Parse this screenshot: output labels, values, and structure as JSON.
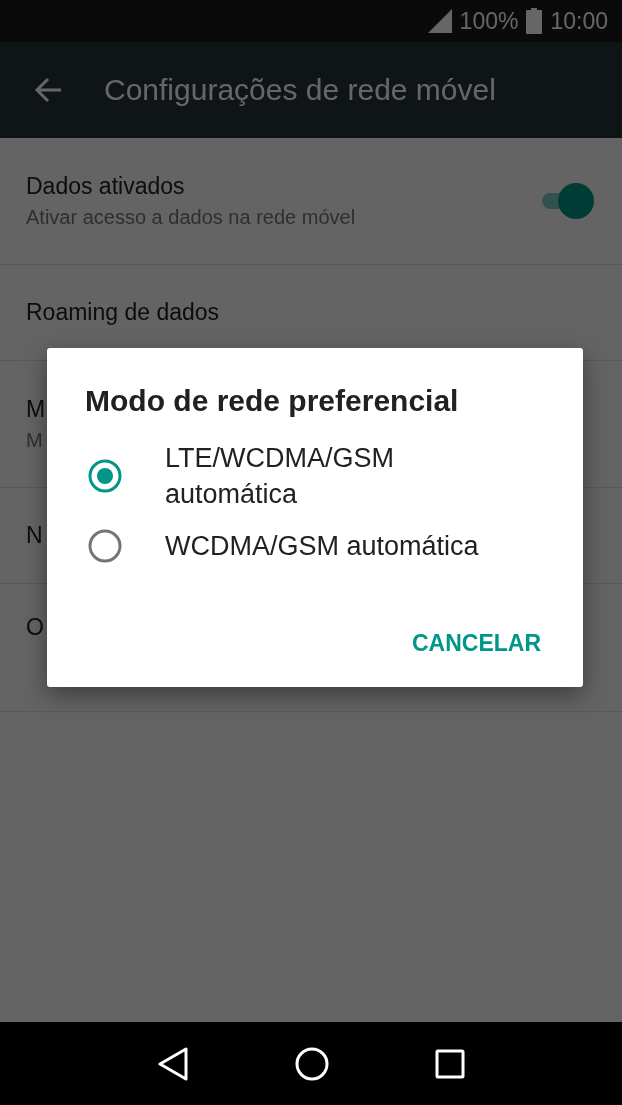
{
  "status_bar": {
    "battery": "100%",
    "time": "10:00"
  },
  "toolbar": {
    "title": "Configurações de rede móvel"
  },
  "settings": [
    {
      "kind": "switch",
      "title": "Dados ativados",
      "subtitle": "Ativar acesso a dados na rede móvel",
      "on": true
    },
    {
      "kind": "text",
      "title": "Roaming de dados"
    },
    {
      "kind": "text",
      "title": "M",
      "subtitle": "M"
    },
    {
      "kind": "text",
      "title": "N"
    },
    {
      "kind": "text",
      "title": "O"
    }
  ],
  "dialog": {
    "title": "Modo de rede preferencial",
    "options": [
      {
        "label": "LTE/WCDMA/GSM automática",
        "selected": true
      },
      {
        "label": "WCDMA/GSM automática",
        "selected": false
      }
    ],
    "buttons": [
      "CANCELAR"
    ]
  }
}
